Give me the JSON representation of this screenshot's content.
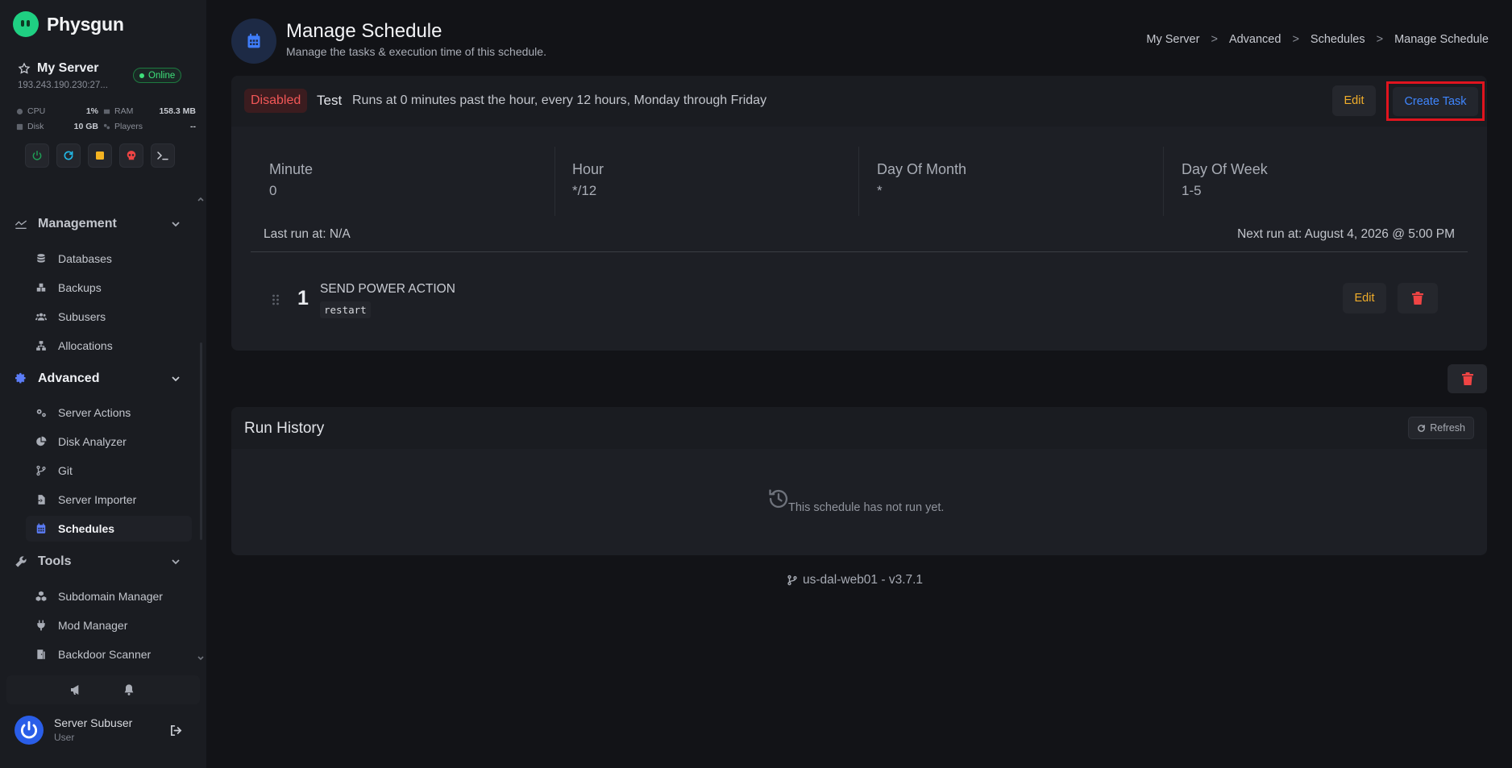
{
  "brand": {
    "name": "Physgun",
    "logo_color": "#1fcf82"
  },
  "server": {
    "name": "My Server",
    "status": "Online",
    "ip": "193.243.190.230:27...",
    "stats": {
      "cpu_label": "CPU",
      "cpu_value": "1%",
      "ram_label": "RAM",
      "ram_value": "158.3 MB",
      "disk_label": "Disk",
      "disk_value": "10 GB",
      "players_label": "Players",
      "players_value": "--"
    },
    "power_buttons": [
      "power-icon",
      "restart-icon",
      "stop-icon",
      "kill-icon",
      "console-icon"
    ]
  },
  "nav": {
    "management": {
      "label": "Management",
      "items": [
        {
          "label": "Databases",
          "icon": "database-icon"
        },
        {
          "label": "Backups",
          "icon": "backup-icon"
        },
        {
          "label": "Subusers",
          "icon": "users-icon"
        },
        {
          "label": "Allocations",
          "icon": "network-icon"
        }
      ]
    },
    "advanced": {
      "label": "Advanced",
      "items": [
        {
          "label": "Server Actions",
          "icon": "gears-icon"
        },
        {
          "label": "Disk Analyzer",
          "icon": "pie-chart-icon"
        },
        {
          "label": "Git",
          "icon": "git-branch-icon"
        },
        {
          "label": "Server Importer",
          "icon": "file-import-icon"
        },
        {
          "label": "Schedules",
          "icon": "calendar-icon"
        }
      ]
    },
    "tools": {
      "label": "Tools",
      "items": [
        {
          "label": "Subdomain Manager",
          "icon": "cubes-icon"
        },
        {
          "label": "Mod Manager",
          "icon": "plug-icon"
        },
        {
          "label": "Backdoor Scanner",
          "icon": "door-icon"
        }
      ]
    }
  },
  "user": {
    "name": "Server Subuser",
    "role": "User"
  },
  "page": {
    "title": "Manage Schedule",
    "subtitle": "Manage the tasks & execution time of this schedule.",
    "breadcrumbs": [
      "My Server",
      "Advanced",
      "Schedules",
      "Manage Schedule"
    ]
  },
  "schedule": {
    "status": "Disabled",
    "name": "Test",
    "description": "Runs at 0 minutes past the hour, every 12 hours, Monday through Friday",
    "edit_label": "Edit",
    "create_task_label": "Create Task",
    "cron": [
      {
        "label": "Minute",
        "value": "0"
      },
      {
        "label": "Hour",
        "value": "*/12"
      },
      {
        "label": "Day Of Month",
        "value": "*"
      },
      {
        "label": "Day Of Week",
        "value": "1-5"
      }
    ],
    "last_run": "Last run at: N/A",
    "next_run": "Next run at: August 4, 2026 @ 5:00 PM",
    "tasks": [
      {
        "number": "1",
        "title": "SEND POWER ACTION",
        "payload": "restart",
        "edit_label": "Edit"
      }
    ]
  },
  "history": {
    "title": "Run History",
    "refresh_label": "Refresh",
    "empty_text": "This schedule has not run yet."
  },
  "footer": {
    "version": "us-dal-web01 - v3.7.1"
  },
  "colors": {
    "accent_blue": "#3f86ff",
    "warning": "#f0ad2a",
    "danger": "#f25757",
    "online": "#3ee07a",
    "highlight_box": "#e0141e"
  }
}
